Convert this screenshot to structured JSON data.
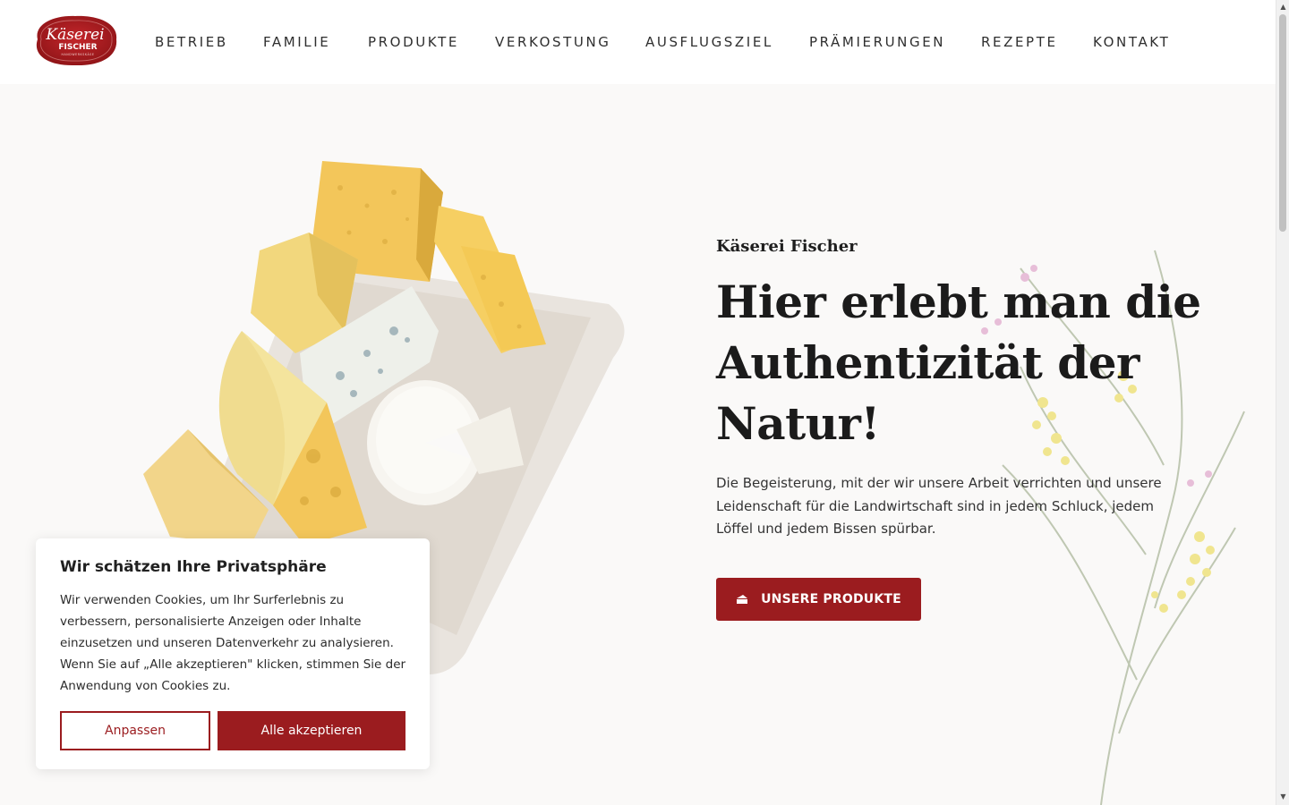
{
  "logo": {
    "line1": "Käserei",
    "line2": "FISCHER",
    "line3": "HANDWERKSKÄSE"
  },
  "nav": {
    "items": [
      {
        "label": "BETRIEB"
      },
      {
        "label": "FAMILIE"
      },
      {
        "label": "PRODUKTE"
      },
      {
        "label": "VERKOSTUNG"
      },
      {
        "label": "AUSFLUGSZIEL"
      },
      {
        "label": "PRÄMIERUNGEN"
      },
      {
        "label": "REZEPTE"
      },
      {
        "label": "KONTAKT"
      }
    ]
  },
  "hero": {
    "eyebrow": "Käserei Fischer",
    "headline": "Hier erlebt man die Authentizität der Natur!",
    "lead": "Die Begeisterung, mit der wir unsere Arbeit verrichten und unsere Leidenschaft für die Landwirtschaft sind in jedem Schluck, jedem Löffel und jedem Bissen spürbar.",
    "cta_label": "UNSERE PRODUKTE",
    "cta_icon": "cheese-icon"
  },
  "cookie": {
    "title": "Wir schätzen Ihre Privatsphäre",
    "text": "Wir verwenden Cookies, um Ihr Surferlebnis zu verbessern, personalisierte Anzeigen oder Inhalte einzusetzen und unseren Datenverkehr zu analysieren. Wenn Sie auf „Alle akzeptieren\" klicken, stimmen Sie der Anwendung von Cookies zu.",
    "customize_label": "Anpassen",
    "accept_label": "Alle akzeptieren"
  },
  "colors": {
    "brand": "#9b1c1f",
    "background": "#faf9f8"
  }
}
